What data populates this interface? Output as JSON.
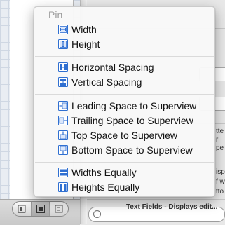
{
  "background": {
    "inspector_fragments": [
      "tte",
      "r",
      "pe",
      "isp",
      "f w",
      "tto"
    ],
    "search_field_fragment": "Text Fields - Displays edit..."
  },
  "menu": {
    "header": "Pin",
    "groups": [
      [
        {
          "label": "Width",
          "icon": "pin-width-icon"
        },
        {
          "label": "Height",
          "icon": "pin-height-icon"
        }
      ],
      [
        {
          "label": "Horizontal Spacing",
          "icon": "horizontal-spacing-icon"
        },
        {
          "label": "Vertical Spacing",
          "icon": "vertical-spacing-icon"
        }
      ],
      [
        {
          "label": "Leading Space to Superview",
          "icon": "leading-space-icon"
        },
        {
          "label": "Trailing Space to Superview",
          "icon": "trailing-space-icon"
        },
        {
          "label": "Top Space to Superview",
          "icon": "top-space-icon"
        },
        {
          "label": "Bottom Space to Superview",
          "icon": "bottom-space-icon"
        }
      ],
      [
        {
          "label": "Widths Equally",
          "icon": "widths-equally-icon"
        },
        {
          "label": "Heights Equally",
          "icon": "heights-equally-icon"
        }
      ]
    ]
  },
  "segmented_control": {
    "buttons": [
      {
        "icon": "align-icon",
        "active": false
      },
      {
        "icon": "pin-icon",
        "active": true
      },
      {
        "icon": "resolve-icon",
        "active": false
      }
    ]
  },
  "colors": {
    "icon_blue": "#2f6fd1",
    "header_gray": "#9b9b9b"
  }
}
